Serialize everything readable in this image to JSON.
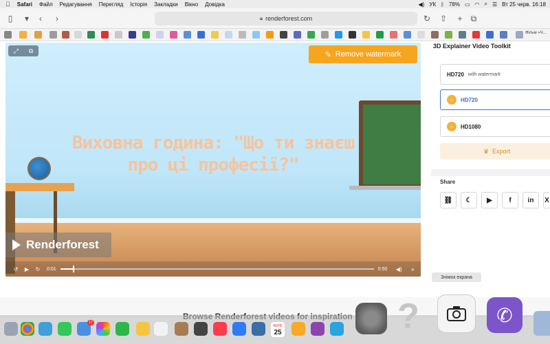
{
  "menubar": {
    "app": "Safari",
    "items": [
      "Файл",
      "Редагування",
      "Перегляд",
      "Історія",
      "Закладки",
      "Вікно",
      "Довідка"
    ],
    "keyboard": "УК",
    "battery": "78%",
    "datetime": "Вт 25 черв.  16:18"
  },
  "toolbar": {
    "url": "renderforest.com"
  },
  "favbar": {
    "last_label": "Фільм «Ч..."
  },
  "video": {
    "title": "Виховна година: \"Що ти знаєш про ці професії?\"",
    "remove_watermark": "Remove watermark",
    "logo": "Renderforest",
    "time_current": "0:01",
    "time_total": "0:50",
    "progress": 0.04
  },
  "sidebar": {
    "title": "3D Explainer Video Toolkit",
    "options": [
      {
        "label": "HD720",
        "sub": "with watermark"
      },
      {
        "label": "HD720",
        "sub": ""
      },
      {
        "label": "HD1080",
        "sub": ""
      }
    ],
    "export": "Export",
    "share_title": "Share",
    "share_icons": [
      "link-icon",
      "messenger-icon",
      "youtube-icon",
      "facebook-icon",
      "linkedin-icon",
      "x-icon"
    ]
  },
  "below": {
    "heading": "Browse Renderforest videos for inspiration"
  },
  "tooltip": "Знімок екрана",
  "dock": {
    "mail_badge": "17",
    "calendar_month": "ЧЕРВ.",
    "calendar_day": "25"
  },
  "colors": {
    "accent": "#f6a51f",
    "selected": "#3b6fd6",
    "title_text": "#f8c39b"
  }
}
